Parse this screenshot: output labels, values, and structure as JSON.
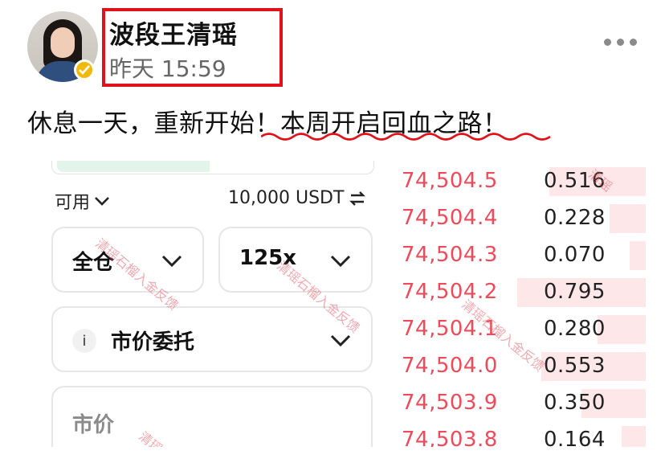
{
  "post": {
    "username": "波段王清瑶",
    "timestamp": "昨天 15:59",
    "text_plain": "休息一天，重新开始！",
    "text_underlined": "本周开启回血之路！"
  },
  "trade_panel": {
    "available_label": "可用",
    "balance": "10,000 USDT",
    "margin_mode": "全仓",
    "leverage": "125x",
    "order_type_info": "i",
    "order_type": "市价委托",
    "price_placeholder": "市价"
  },
  "order_book": {
    "asks": [
      {
        "price": "74,504.5",
        "amount": "0.516"
      },
      {
        "price": "74,504.4",
        "amount": "0.228"
      },
      {
        "price": "74,504.3",
        "amount": "0.070"
      },
      {
        "price": "74,504.2",
        "amount": "0.795"
      },
      {
        "price": "74,504.1",
        "amount": "0.280"
      },
      {
        "price": "74,504.0",
        "amount": "0.553"
      },
      {
        "price": "74,503.9",
        "amount": "0.350"
      },
      {
        "price": "74,503.8",
        "amount": "0.164"
      }
    ]
  },
  "watermark": {
    "text": "清瑶石榴入金反馈",
    "text_partial": "清瑶"
  },
  "colors": {
    "highlight_border": "#e0131c",
    "ask_price": "#ef4a5a",
    "depth_bar": "#fde7e9",
    "verified_badge": "#f0b90b"
  },
  "icons": [
    "verified-badge-icon",
    "more-options-icon",
    "chevron-down-icon",
    "swap-icon",
    "info-icon"
  ]
}
